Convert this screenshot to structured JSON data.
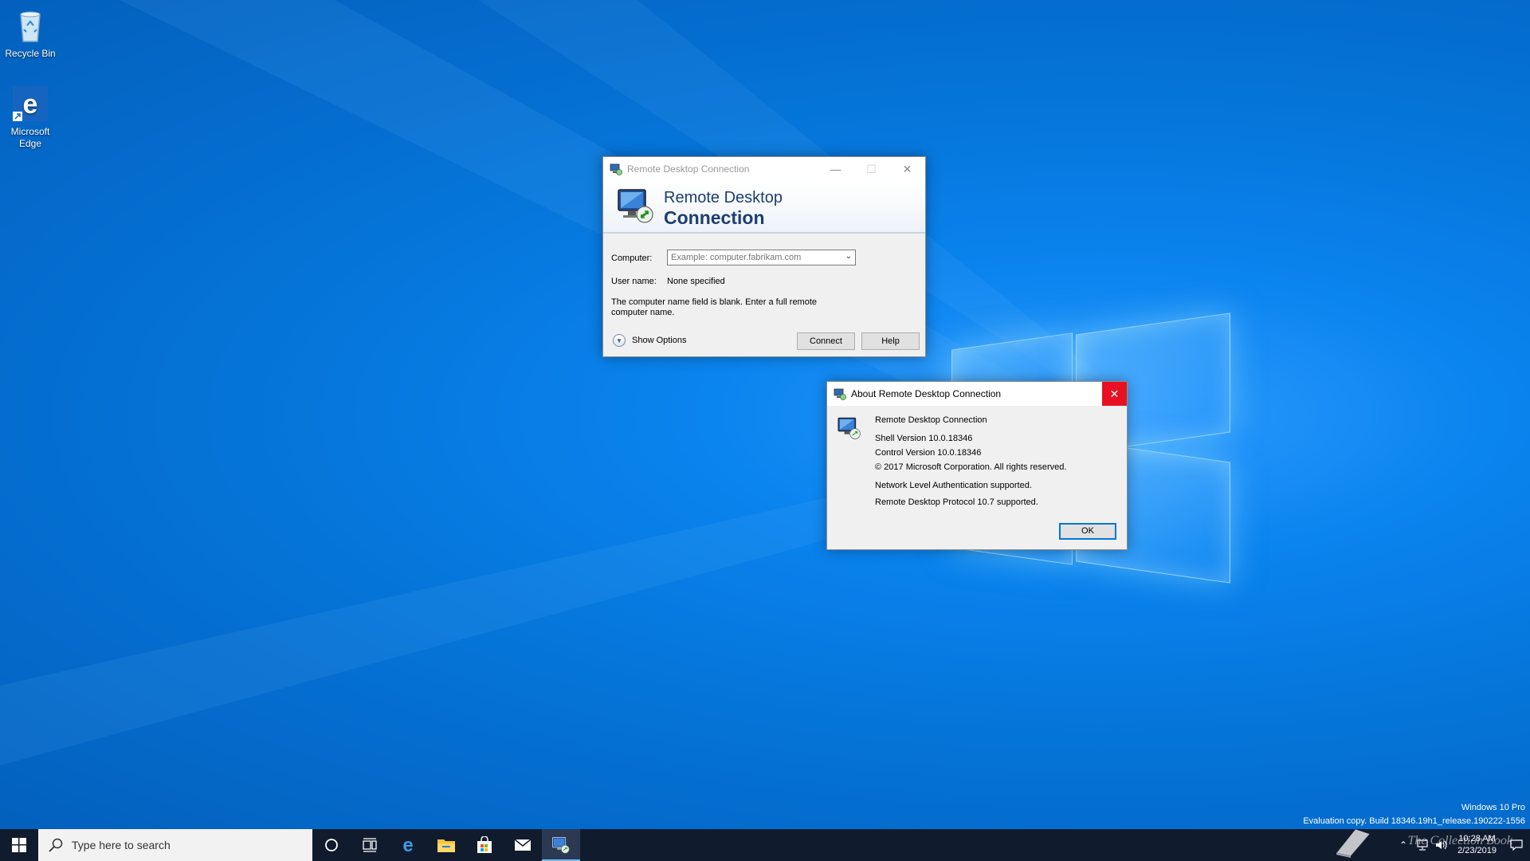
{
  "desktop": {
    "icons": [
      {
        "label": "Recycle Bin",
        "icon": "recycle-bin-icon"
      },
      {
        "label": "Microsoft Edge",
        "icon": "edge-icon"
      }
    ]
  },
  "rdc_window": {
    "title": "Remote Desktop Connection",
    "banner_line1": "Remote Desktop",
    "banner_line2": "Connection",
    "computer_label": "Computer:",
    "computer_placeholder": "Example: computer.fabrikam.com",
    "username_label": "User name:",
    "username_value": "None specified",
    "message": "The computer name field is blank. Enter a full remote computer name.",
    "show_options": "Show Options",
    "connect_label": "Connect",
    "help_label": "Help"
  },
  "about_dialog": {
    "title": "About Remote Desktop Connection",
    "app_name": "Remote Desktop Connection",
    "shell_version": "Shell Version 10.0.18346",
    "control_version": "Control Version 10.0.18346",
    "copyright": "© 2017 Microsoft Corporation. All rights reserved.",
    "nla": "Network Level Authentication supported.",
    "protocol": "Remote Desktop Protocol 10.7 supported.",
    "ok_label": "OK"
  },
  "taskbar": {
    "search_placeholder": "Type here to search",
    "pinned": [
      "cortana-icon",
      "task-view-icon",
      "edge-icon",
      "file-explorer-icon",
      "store-icon",
      "mail-icon",
      "remote-desktop-icon"
    ],
    "clock_time": "10:28 AM",
    "clock_date": "2/23/2019"
  },
  "watermark": {
    "line1": "Windows 10 Pro",
    "line2": "Evaluation copy. Build 18346.19h1_release.190222-1556"
  },
  "overlay_text": "The Collection Book",
  "colors": {
    "accent": "#0078d7",
    "close_red": "#e81123",
    "taskbar": "#101b2e"
  }
}
